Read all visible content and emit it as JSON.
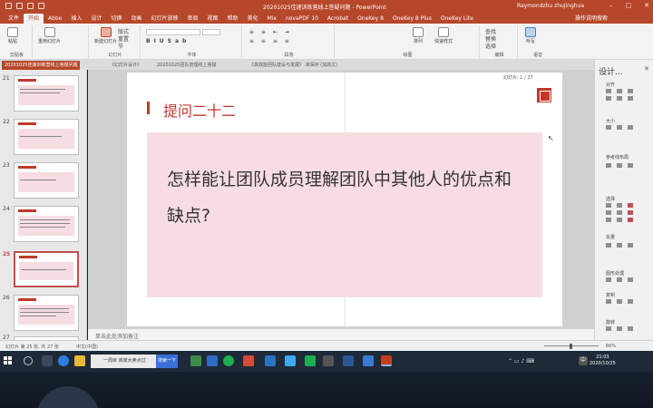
{
  "window": {
    "title": "20201025佳速训练营线上答疑问题 - PowerPoint",
    "user": "Raymondzhu zhujinghua"
  },
  "tabs": [
    "文件",
    "开始",
    "Abbo",
    "插入",
    "设计",
    "切换",
    "动画",
    "幻灯片放映",
    "审阅",
    "视图",
    "帮助",
    "美化",
    "Mix",
    "novaPDF 10",
    "Acrobat",
    "OneKey 8",
    "OneKey 8 Plus",
    "OneKey Lite",
    "操作说明搜索"
  ],
  "ribbon": {
    "groups": [
      "剪贴板",
      "幻灯片",
      "字体",
      "段落",
      "绘图",
      "编辑",
      "语音"
    ],
    "buttons": {
      "paste": "粘贴",
      "reuse": "重用幻灯片",
      "new_slide": "新建幻灯片",
      "layout": "版式",
      "reset": "重置",
      "section": "节",
      "arrange": "排列",
      "quick_styles": "快速样式",
      "find": "查找",
      "replace": "替换",
      "select": "选择",
      "dictate": "听写"
    }
  },
  "doc_tabs": [
    "20201025佳速训练营线上答疑问题",
    "《幻灯片设计》",
    "20201025团队管理线上答疑",
    "《高效能团队建设与发展》 未保存 (加高文)"
  ],
  "slides": [
    {
      "num": "21"
    },
    {
      "num": "22"
    },
    {
      "num": "23"
    },
    {
      "num": "24"
    },
    {
      "num": "25"
    },
    {
      "num": "26"
    },
    {
      "num": "27"
    }
  ],
  "current_slide": {
    "heading": "提问二十二",
    "question": "怎样能让团队成员理解团队中其他人的优点和缺点?",
    "slide_counter": "幻灯片: 1 / 27"
  },
  "notes_placeholder": "单击此处添加备注",
  "design_pane": {
    "title": "设计...",
    "sections": [
      "对齐",
      "大小",
      "参考线布局",
      "选择",
      "矢量",
      "图形处理",
      "复制",
      "旋转"
    ]
  },
  "statusbar": {
    "slide_info": "幻灯片 第 25 张, 共 27 张",
    "language": "中文(中国)",
    "zoom": "66%"
  },
  "taskbar": {
    "search_text": "一周目 商家大卖点过",
    "search_button": "搜索一下",
    "time": "21:03",
    "date": "2020/10/25",
    "ime": "中"
  }
}
